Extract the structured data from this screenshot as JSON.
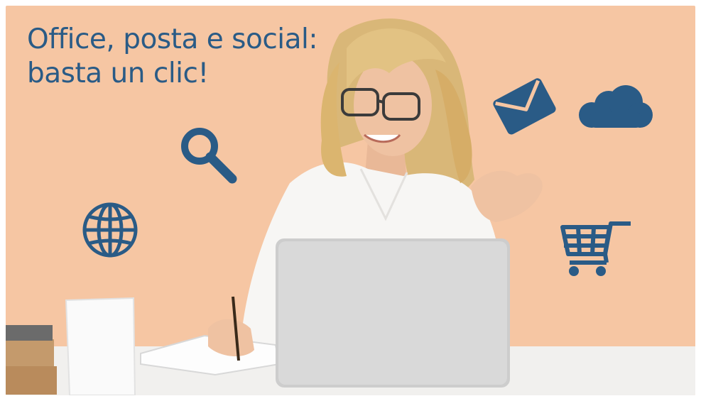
{
  "headline": {
    "line1": "Office, posta e social:",
    "line2": "basta un clic!"
  },
  "colors": {
    "background": "#f6c6a3",
    "accent": "#2a5b86"
  },
  "icons": [
    "search-icon",
    "globe-icon",
    "envelope-icon",
    "cloud-icon",
    "shopping-cart-icon"
  ]
}
